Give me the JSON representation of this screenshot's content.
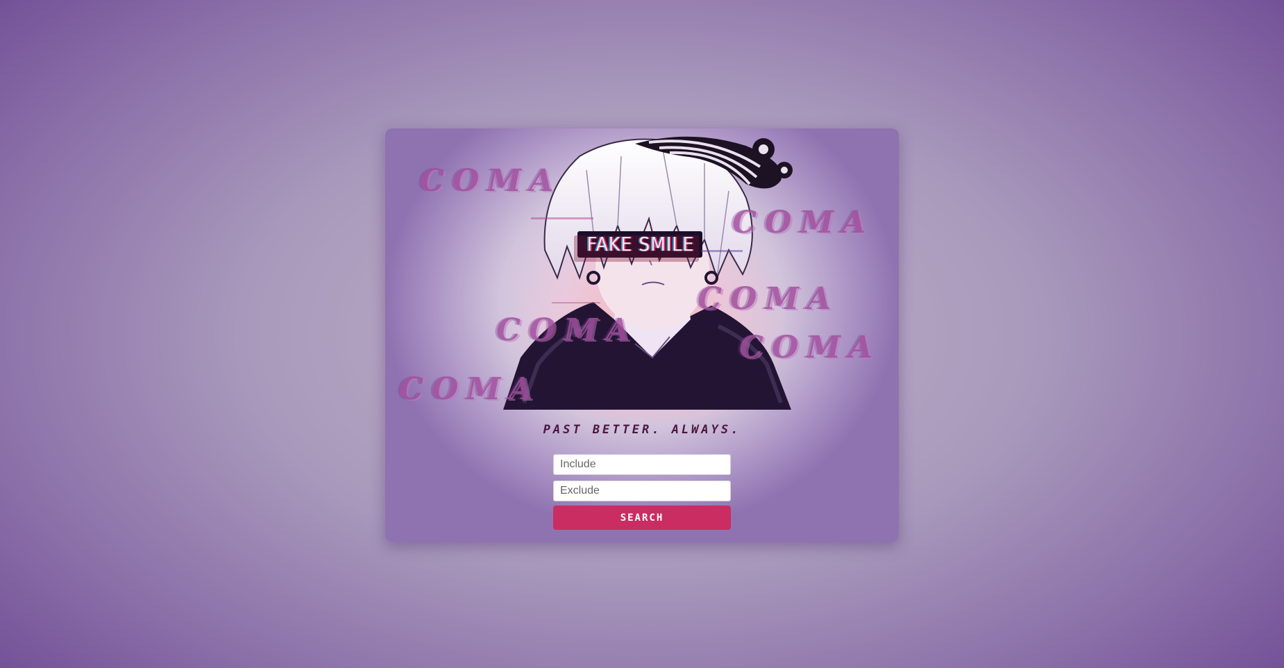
{
  "artwork": {
    "badge_text": "FAKE SMILE",
    "watermark_words": [
      "COMA",
      "COMA",
      "COMA",
      "COMA",
      "COMA",
      "COMA"
    ]
  },
  "tagline": "PAST BETTER. ALWAYS.",
  "search_form": {
    "include_placeholder": "Include",
    "include_value": "",
    "exclude_placeholder": "Exclude",
    "exclude_value": "",
    "search_label": "SEARCH"
  },
  "colors": {
    "accent": "#c92d62",
    "watermark": "#a2509f",
    "tagline": "#4a1740"
  }
}
